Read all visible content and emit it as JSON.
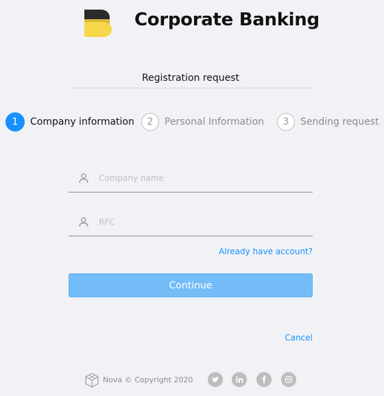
{
  "header": {
    "logo_icon": "b-logo-icon",
    "app_title": "Corporate Banking"
  },
  "form": {
    "title": "Registration request",
    "steps": [
      {
        "number": "1",
        "label": "Company information",
        "active": true
      },
      {
        "number": "2",
        "label": "Personal Information",
        "active": false
      },
      {
        "number": "3",
        "label": "Sending request",
        "active": false
      }
    ],
    "company_name": {
      "value": "",
      "placeholder": "Company name",
      "icon": "user-icon"
    },
    "rfc": {
      "value": "",
      "placeholder": "RFC",
      "icon": "user-icon"
    },
    "already_account_link": "Already have account?",
    "continue_label": "Continue",
    "cancel_label": "Cancel"
  },
  "footer": {
    "copyright": "Nova © Copyright 2020",
    "social": [
      "twitter-icon",
      "linkedin-icon",
      "facebook-icon",
      "instagram-icon"
    ]
  },
  "colors": {
    "accent": "#1890ff",
    "continue_bg": "#74bcf7",
    "logo_dark": "#2b2b2b",
    "logo_yellow": "#f7d64a",
    "background": "#f0f2f5"
  }
}
